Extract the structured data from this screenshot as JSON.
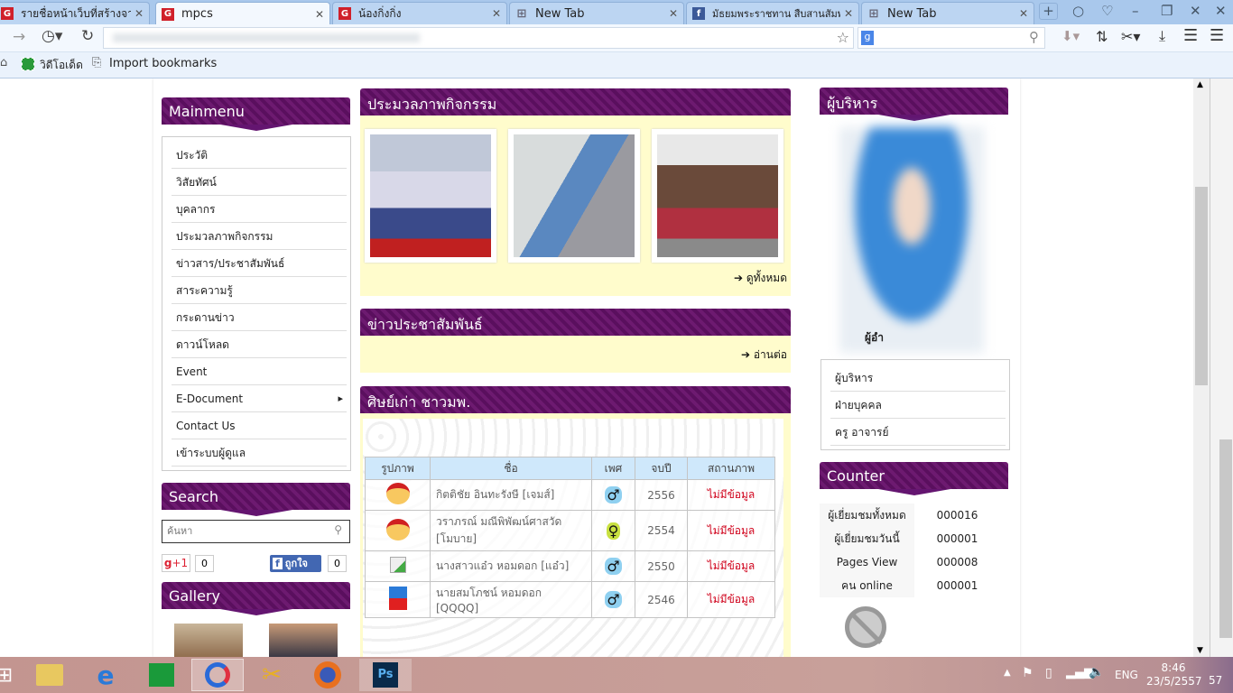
{
  "browser": {
    "tabs": [
      {
        "title": "รายชื่อหน้าเว็บที่สร้างจากโมดูล",
        "icon": "g-icon"
      },
      {
        "title": "mpcs",
        "icon": "g-icon",
        "active": true
      },
      {
        "title": "น้องกิ่งกิ่ง",
        "icon": "g-icon"
      },
      {
        "title": "New Tab",
        "icon": "grid-icon"
      },
      {
        "title": "มัธยมพระราชทาน สืบสานสัมพันธ์",
        "icon": "facebook-icon"
      },
      {
        "title": "New Tab",
        "icon": "grid-icon"
      }
    ],
    "bookmarks": [
      {
        "label": "วิดีโอเด็ด"
      },
      {
        "label": "Import bookmarks"
      }
    ]
  },
  "mainmenu": {
    "title": "Mainmenu",
    "items": [
      "ประวัติ",
      "วิสัยทัศน์",
      "บุคลากร",
      "ประมวลภาพกิจกรรม",
      "ข่าวสาร/ประชาสัมพันธ์",
      "สาระความรู้",
      "กระดานข่าว",
      "ดาวน์โหลด",
      "Event",
      "E-Document",
      "Contact Us",
      "เข้าระบบผู้ดูแล"
    ]
  },
  "search": {
    "title": "Search",
    "placeholder": "ค้นหา",
    "gplus_label": "+1",
    "gplus_count": "0",
    "fb_label": "ถูกใจ",
    "fb_count": "0"
  },
  "gallery": {
    "title": "Gallery"
  },
  "activities": {
    "title": "ประมวลภาพกิจกรรม",
    "view_all": "ดูทั้งหมด"
  },
  "news": {
    "title": "ข่าวประชาสัมพันธ์",
    "read_more": "อ่านต่อ"
  },
  "alumni": {
    "title": "ศิษย์เก่า ชาวมพ.",
    "columns": [
      "รูปภาพ",
      "ชื่อ",
      "เพศ",
      "จบปี",
      "สถานภาพ"
    ],
    "rows": [
      {
        "name": "กิตติชัย อินทะรังษี [เจมส์]",
        "gender": "male",
        "year": "2556",
        "status": "ไม่มีข้อมูล",
        "photo": "avatar-cartoon"
      },
      {
        "name": "วราภรณ์ มณีพิพัฒน์ศาสวัด [โมบาย]",
        "gender": "female",
        "year": "2554",
        "status": "ไม่มีข้อมูล",
        "photo": "avatar-cartoon"
      },
      {
        "name": "นางสาวแอ๋ว หอมดอก [แอ๋ว]",
        "gender": "male",
        "year": "2550",
        "status": "ไม่มีข้อมูล",
        "photo": "broken-image"
      },
      {
        "name": "นายสมโภชน์ หอมดอก [QQQQ]",
        "gender": "male",
        "year": "2546",
        "status": "ไม่มีข้อมูล",
        "photo": "photo"
      }
    ]
  },
  "executive": {
    "title": "ผู้บริหาร",
    "caption": "ผู้อำ",
    "menu": [
      "ผู้บริหาร",
      "ฝ่ายบุคคล",
      "ครู อาจารย์"
    ]
  },
  "counter": {
    "title": "Counter",
    "rows": [
      {
        "label": "ผู้เยี่ยมชมทั้งหมด",
        "value": "000016"
      },
      {
        "label": "ผู้เยี่ยมชมวันนี้",
        "value": "000001"
      },
      {
        "label": "Pages View",
        "value": "000008"
      },
      {
        "label": "คน online",
        "value": "000001"
      }
    ]
  },
  "taskbar": {
    "lang": "ENG",
    "time": "8:46",
    "date": "23/5/2557",
    "extra": "57"
  },
  "colors": {
    "header": "#641570",
    "panel": "#fffccc",
    "table_header": "#cfe8fb",
    "status": "#d0021b"
  }
}
